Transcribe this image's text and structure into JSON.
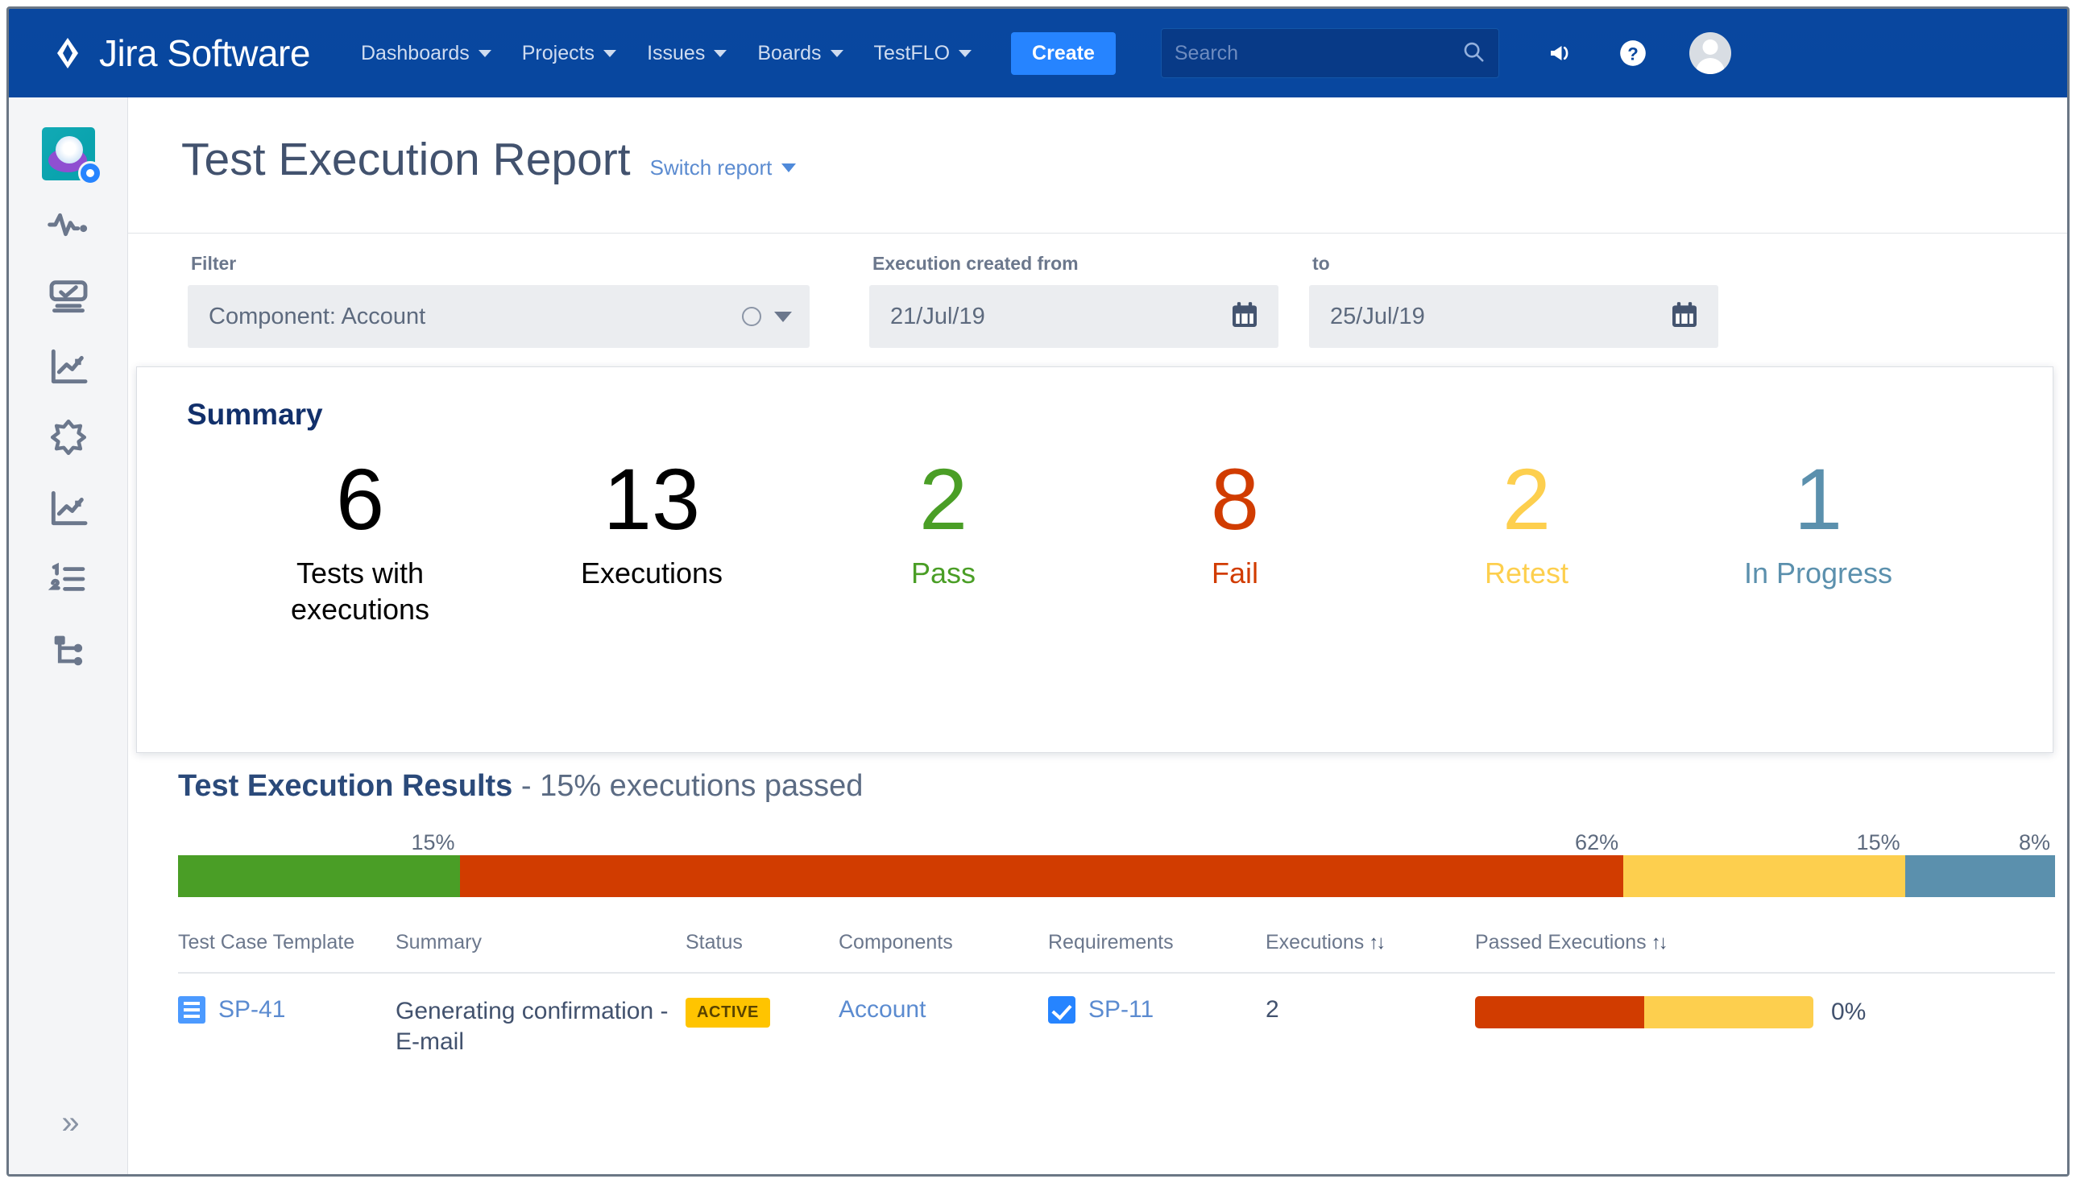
{
  "navbar": {
    "product_name": "Jira Software",
    "menu_items": [
      {
        "label": "Dashboards"
      },
      {
        "label": "Projects"
      },
      {
        "label": "Issues"
      },
      {
        "label": "Boards"
      },
      {
        "label": "TestFLO"
      }
    ],
    "create_label": "Create",
    "search_placeholder": "Search",
    "icons": {
      "notifications": "megaphone-icon",
      "help": "help-icon",
      "avatar": "user-avatar"
    },
    "colors": {
      "bar": "#08479f",
      "create_button": "#2684ff",
      "search_field": "#083a87"
    }
  },
  "sidebar": {
    "items": [
      {
        "name": "project-avatar",
        "icon": "project-avatar-icon"
      },
      {
        "name": "activity",
        "icon": "pulse-icon"
      },
      {
        "name": "board",
        "icon": "board-icon"
      },
      {
        "name": "reports",
        "icon": "chart-icon"
      },
      {
        "name": "sprint",
        "icon": "starburst-icon"
      },
      {
        "name": "reports-2",
        "icon": "chart-icon"
      },
      {
        "name": "backlog",
        "icon": "ordered-list-icon"
      },
      {
        "name": "structure",
        "icon": "branch-icon"
      }
    ],
    "expand_label": "»"
  },
  "header": {
    "title": "Test Execution Report",
    "switch_report_label": "Switch report"
  },
  "filters": {
    "filter_label": "Filter",
    "filter_value": "Component: Account",
    "date_from_label": "Execution created from",
    "date_from_value": "21/Jul/19",
    "date_to_label": "to",
    "date_to_value": "25/Jul/19"
  },
  "summary": {
    "title": "Summary",
    "stats": [
      {
        "value": "6",
        "label": "Tests with executions",
        "color": "#000000"
      },
      {
        "value": "13",
        "label": "Executions",
        "color": "#000000"
      },
      {
        "value": "2",
        "label": "Pass",
        "color": "#4a9e26"
      },
      {
        "value": "8",
        "label": "Fail",
        "color": "#d13c00"
      },
      {
        "value": "2",
        "label": "Retest",
        "color": "#fdcf4e"
      },
      {
        "value": "1",
        "label": "In Progress",
        "color": "#5b90ad"
      }
    ]
  },
  "results": {
    "heading_strong": "Test Execution Results",
    "heading_rest": " - 15% executions passed",
    "table": {
      "columns": [
        {
          "label": "Test Case Template",
          "sortable": false
        },
        {
          "label": "Summary",
          "sortable": false
        },
        {
          "label": "Status",
          "sortable": false
        },
        {
          "label": "Components",
          "sortable": false
        },
        {
          "label": "Requirements",
          "sortable": false
        },
        {
          "label": "Executions",
          "sortable": true,
          "sort_glyph": "↑↓"
        },
        {
          "label": "Passed Executions",
          "sortable": true,
          "sort_glyph": "↑↓"
        }
      ],
      "rows": [
        {
          "test_case_template": "SP-41",
          "summary": "Generating confirmation - E-mail",
          "status": "ACTIVE",
          "components": "Account",
          "requirements": "SP-11",
          "executions": "2",
          "passed_percent": "0%",
          "passed_bar": [
            {
              "color": "#d13c00",
              "percent": 50
            },
            {
              "color": "#fdcf4e",
              "percent": 50
            }
          ]
        }
      ]
    }
  },
  "chart_data": {
    "type": "bar",
    "title": "Test Execution Results - 15% executions passed",
    "orientation": "horizontal-stacked",
    "categories": [
      "Pass",
      "Fail",
      "Retest",
      "In Progress"
    ],
    "values": [
      15,
      62,
      15,
      8
    ],
    "labels": [
      "15%",
      "62%",
      "15%",
      "8%"
    ],
    "colors": [
      "#4a9e26",
      "#d13c00",
      "#fdcf4e",
      "#5b90ad"
    ],
    "counts": [
      2,
      8,
      2,
      1
    ],
    "total_executions": 13,
    "xlabel": "",
    "ylabel": "",
    "xlim": [
      0,
      100
    ],
    "grid": false,
    "legend": "none",
    "annotations": [
      {
        "text": "15%",
        "at_percent": 15
      },
      {
        "text": "62%",
        "at_percent": 77
      },
      {
        "text": "15%",
        "at_percent": 92
      },
      {
        "text": "8%",
        "at_percent": 100
      }
    ]
  }
}
